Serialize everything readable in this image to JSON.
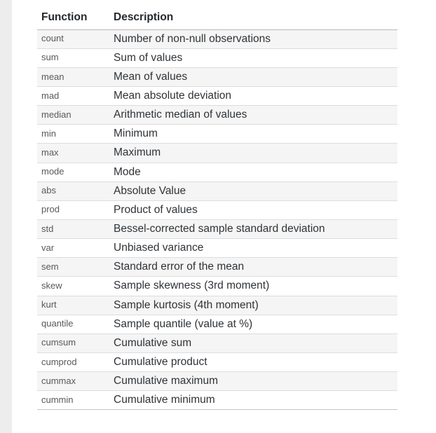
{
  "table": {
    "headers": {
      "function": "Function",
      "description": "Description"
    },
    "rows": [
      {
        "function": "count",
        "description": "Number of non-null observations"
      },
      {
        "function": "sum",
        "description": "Sum of values"
      },
      {
        "function": "mean",
        "description": "Mean of values"
      },
      {
        "function": "mad",
        "description": "Mean absolute deviation"
      },
      {
        "function": "median",
        "description": "Arithmetic median of values"
      },
      {
        "function": "min",
        "description": "Minimum"
      },
      {
        "function": "max",
        "description": "Maximum"
      },
      {
        "function": "mode",
        "description": "Mode"
      },
      {
        "function": "abs",
        "description": "Absolute Value"
      },
      {
        "function": "prod",
        "description": "Product of values"
      },
      {
        "function": "std",
        "description": "Bessel-corrected sample standard deviation"
      },
      {
        "function": "var",
        "description": "Unbiased variance"
      },
      {
        "function": "sem",
        "description": "Standard error of the mean"
      },
      {
        "function": "skew",
        "description": "Sample skewness (3rd moment)"
      },
      {
        "function": "kurt",
        "description": "Sample kurtosis (4th moment)"
      },
      {
        "function": "quantile",
        "description": "Sample quantile (value at %)"
      },
      {
        "function": "cumsum",
        "description": "Cumulative sum"
      },
      {
        "function": "cumprod",
        "description": "Cumulative product"
      },
      {
        "function": "cummax",
        "description": "Cumulative maximum"
      },
      {
        "function": "cummin",
        "description": "Cumulative minimum"
      }
    ]
  },
  "colors": {
    "row_shaded": "#f5f5f5",
    "row_plain": "#ffffff",
    "border_top": "#b9b9b9",
    "border_bottom": "#dddddd",
    "gutter": "#ededed",
    "header_text": "#24292e",
    "function_text": "#595959",
    "description_text": "#2f3337"
  }
}
